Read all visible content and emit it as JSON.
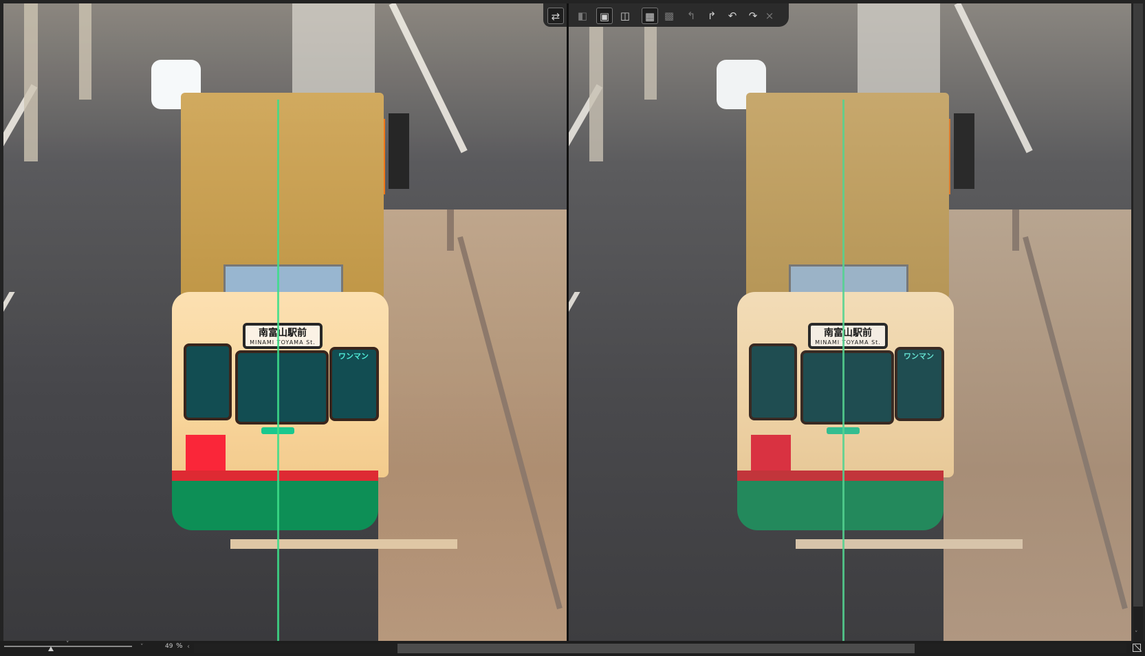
{
  "toolbar_left": {
    "swap_icon": "⇄"
  },
  "toolbar_right": {
    "buttons": [
      {
        "name": "view-before-icon",
        "glyph": "◧"
      },
      {
        "name": "view-single-icon",
        "glyph": "▣"
      },
      {
        "name": "view-split-icon",
        "glyph": "◫"
      },
      {
        "name": "view-side-by-side-icon",
        "glyph": "▦"
      },
      {
        "name": "view-compare-icon",
        "glyph": "▩"
      },
      {
        "name": "copy-to-left-icon",
        "glyph": "↰"
      },
      {
        "name": "copy-to-right-icon",
        "glyph": "↱"
      },
      {
        "name": "undo-icon",
        "glyph": "↶"
      },
      {
        "name": "redo-icon",
        "glyph": "↷"
      },
      {
        "name": "close-icon",
        "glyph": "×"
      }
    ]
  },
  "tram_sign": {
    "line1": "南富山駅前",
    "line2": "MINAMI TOYAMA St."
  },
  "tram_side_label": "ワンマン",
  "statusbar": {
    "zoom_value": "49",
    "zoom_unit": "%",
    "zoom_dropdown_glyph": "˅",
    "zoom_marker_glyph": "˅",
    "scroll_left_glyph": "‹",
    "scroll_down_glyph": "˅"
  },
  "colors": {
    "background": "#232323",
    "toolbar": "#2b2b2b",
    "accent_border": "#777777"
  }
}
